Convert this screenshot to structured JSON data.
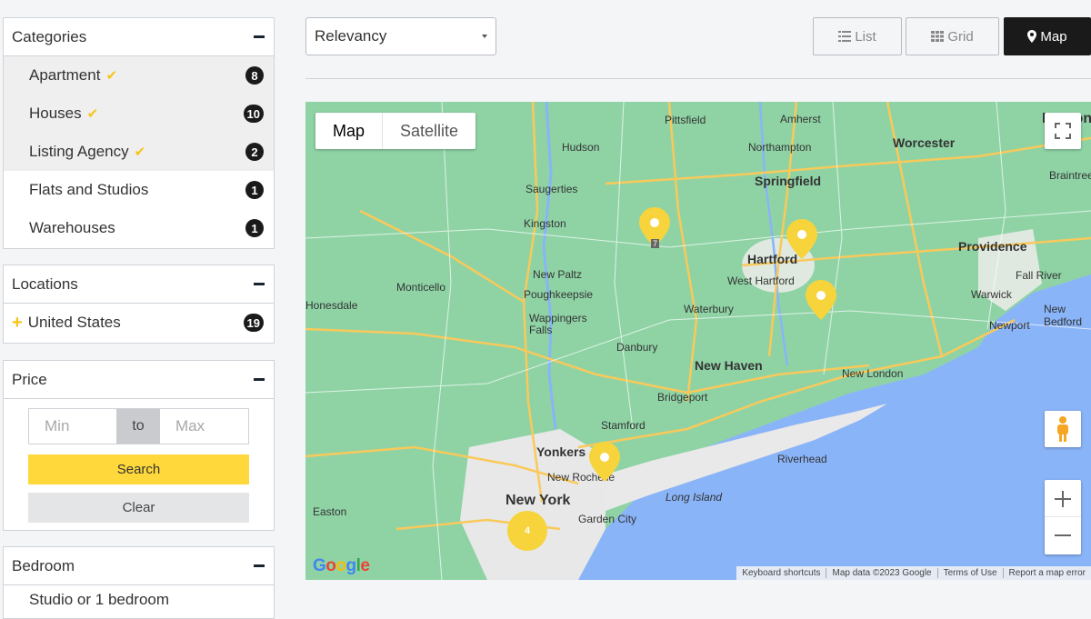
{
  "categories": {
    "title": "Categories",
    "items": [
      {
        "label": "Apartment",
        "count": "8",
        "checked": true
      },
      {
        "label": "Houses",
        "count": "10",
        "checked": true
      },
      {
        "label": "Listing Agency",
        "count": "2",
        "checked": true
      },
      {
        "label": "Flats and Studios",
        "count": "1",
        "checked": false
      },
      {
        "label": "Warehouses",
        "count": "1",
        "checked": false
      }
    ]
  },
  "locations": {
    "title": "Locations",
    "items": [
      {
        "label": "United States",
        "count": "19"
      }
    ]
  },
  "price": {
    "title": "Price",
    "min_placeholder": "Min",
    "to_label": "to",
    "max_placeholder": "Max",
    "search_label": "Search",
    "clear_label": "Clear"
  },
  "bedroom": {
    "title": "Bedroom",
    "first_option": "Studio or 1 bedroom"
  },
  "toolbar": {
    "sort_value": "Relevancy",
    "list_label": "List",
    "grid_label": "Grid",
    "map_label": "Map"
  },
  "map": {
    "type_map": "Map",
    "type_satellite": "Satellite",
    "cluster_count": "4",
    "pin_cluster_label": "7",
    "cities": [
      "Pittsfield",
      "Amherst",
      "Boston",
      "Hudson",
      "Northampton",
      "Worcester",
      "Braintree",
      "Saugerties",
      "Springfield",
      "Kingston",
      "Hartford",
      "Providence",
      "West Hartford",
      "New Paltz",
      "Monticello",
      "Poughkeepsie",
      "Fall River",
      "Warwick",
      "New Bedford",
      "Honesdale",
      "Wappingers Falls",
      "Waterbury",
      "Newport",
      "Danbury",
      "New Haven",
      "New London",
      "Bridgeport",
      "Stamford",
      "Riverhead",
      "Yonkers",
      "New Rochelle",
      "New York",
      "Long Island",
      "Garden City",
      "Easton"
    ],
    "footer": [
      "Keyboard shortcuts",
      "Map data ©2023 Google",
      "Terms of Use",
      "Report a map error"
    ],
    "logo": "Google"
  },
  "colors": {
    "accent": "#ffd83b",
    "badge": "#1a1a1a",
    "active_view": "#1a1a1a",
    "land": "#8fd3a5",
    "water": "#8ab4f8",
    "urban": "#e8e8e8",
    "road": "#f9c95a",
    "pin": "#f7d33c"
  }
}
